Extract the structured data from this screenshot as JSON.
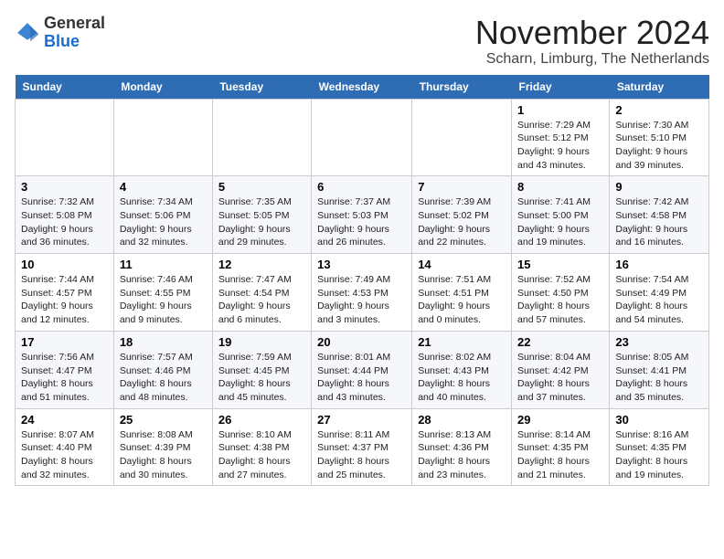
{
  "header": {
    "logo_general": "General",
    "logo_blue": "Blue",
    "month_title": "November 2024",
    "location": "Scharn, Limburg, The Netherlands"
  },
  "days_of_week": [
    "Sunday",
    "Monday",
    "Tuesday",
    "Wednesday",
    "Thursday",
    "Friday",
    "Saturday"
  ],
  "weeks": [
    [
      {
        "day": "",
        "info": ""
      },
      {
        "day": "",
        "info": ""
      },
      {
        "day": "",
        "info": ""
      },
      {
        "day": "",
        "info": ""
      },
      {
        "day": "",
        "info": ""
      },
      {
        "day": "1",
        "info": "Sunrise: 7:29 AM\nSunset: 5:12 PM\nDaylight: 9 hours and 43 minutes."
      },
      {
        "day": "2",
        "info": "Sunrise: 7:30 AM\nSunset: 5:10 PM\nDaylight: 9 hours and 39 minutes."
      }
    ],
    [
      {
        "day": "3",
        "info": "Sunrise: 7:32 AM\nSunset: 5:08 PM\nDaylight: 9 hours and 36 minutes."
      },
      {
        "day": "4",
        "info": "Sunrise: 7:34 AM\nSunset: 5:06 PM\nDaylight: 9 hours and 32 minutes."
      },
      {
        "day": "5",
        "info": "Sunrise: 7:35 AM\nSunset: 5:05 PM\nDaylight: 9 hours and 29 minutes."
      },
      {
        "day": "6",
        "info": "Sunrise: 7:37 AM\nSunset: 5:03 PM\nDaylight: 9 hours and 26 minutes."
      },
      {
        "day": "7",
        "info": "Sunrise: 7:39 AM\nSunset: 5:02 PM\nDaylight: 9 hours and 22 minutes."
      },
      {
        "day": "8",
        "info": "Sunrise: 7:41 AM\nSunset: 5:00 PM\nDaylight: 9 hours and 19 minutes."
      },
      {
        "day": "9",
        "info": "Sunrise: 7:42 AM\nSunset: 4:58 PM\nDaylight: 9 hours and 16 minutes."
      }
    ],
    [
      {
        "day": "10",
        "info": "Sunrise: 7:44 AM\nSunset: 4:57 PM\nDaylight: 9 hours and 12 minutes."
      },
      {
        "day": "11",
        "info": "Sunrise: 7:46 AM\nSunset: 4:55 PM\nDaylight: 9 hours and 9 minutes."
      },
      {
        "day": "12",
        "info": "Sunrise: 7:47 AM\nSunset: 4:54 PM\nDaylight: 9 hours and 6 minutes."
      },
      {
        "day": "13",
        "info": "Sunrise: 7:49 AM\nSunset: 4:53 PM\nDaylight: 9 hours and 3 minutes."
      },
      {
        "day": "14",
        "info": "Sunrise: 7:51 AM\nSunset: 4:51 PM\nDaylight: 9 hours and 0 minutes."
      },
      {
        "day": "15",
        "info": "Sunrise: 7:52 AM\nSunset: 4:50 PM\nDaylight: 8 hours and 57 minutes."
      },
      {
        "day": "16",
        "info": "Sunrise: 7:54 AM\nSunset: 4:49 PM\nDaylight: 8 hours and 54 minutes."
      }
    ],
    [
      {
        "day": "17",
        "info": "Sunrise: 7:56 AM\nSunset: 4:47 PM\nDaylight: 8 hours and 51 minutes."
      },
      {
        "day": "18",
        "info": "Sunrise: 7:57 AM\nSunset: 4:46 PM\nDaylight: 8 hours and 48 minutes."
      },
      {
        "day": "19",
        "info": "Sunrise: 7:59 AM\nSunset: 4:45 PM\nDaylight: 8 hours and 45 minutes."
      },
      {
        "day": "20",
        "info": "Sunrise: 8:01 AM\nSunset: 4:44 PM\nDaylight: 8 hours and 43 minutes."
      },
      {
        "day": "21",
        "info": "Sunrise: 8:02 AM\nSunset: 4:43 PM\nDaylight: 8 hours and 40 minutes."
      },
      {
        "day": "22",
        "info": "Sunrise: 8:04 AM\nSunset: 4:42 PM\nDaylight: 8 hours and 37 minutes."
      },
      {
        "day": "23",
        "info": "Sunrise: 8:05 AM\nSunset: 4:41 PM\nDaylight: 8 hours and 35 minutes."
      }
    ],
    [
      {
        "day": "24",
        "info": "Sunrise: 8:07 AM\nSunset: 4:40 PM\nDaylight: 8 hours and 32 minutes."
      },
      {
        "day": "25",
        "info": "Sunrise: 8:08 AM\nSunset: 4:39 PM\nDaylight: 8 hours and 30 minutes."
      },
      {
        "day": "26",
        "info": "Sunrise: 8:10 AM\nSunset: 4:38 PM\nDaylight: 8 hours and 27 minutes."
      },
      {
        "day": "27",
        "info": "Sunrise: 8:11 AM\nSunset: 4:37 PM\nDaylight: 8 hours and 25 minutes."
      },
      {
        "day": "28",
        "info": "Sunrise: 8:13 AM\nSunset: 4:36 PM\nDaylight: 8 hours and 23 minutes."
      },
      {
        "day": "29",
        "info": "Sunrise: 8:14 AM\nSunset: 4:35 PM\nDaylight: 8 hours and 21 minutes."
      },
      {
        "day": "30",
        "info": "Sunrise: 8:16 AM\nSunset: 4:35 PM\nDaylight: 8 hours and 19 minutes."
      }
    ]
  ]
}
